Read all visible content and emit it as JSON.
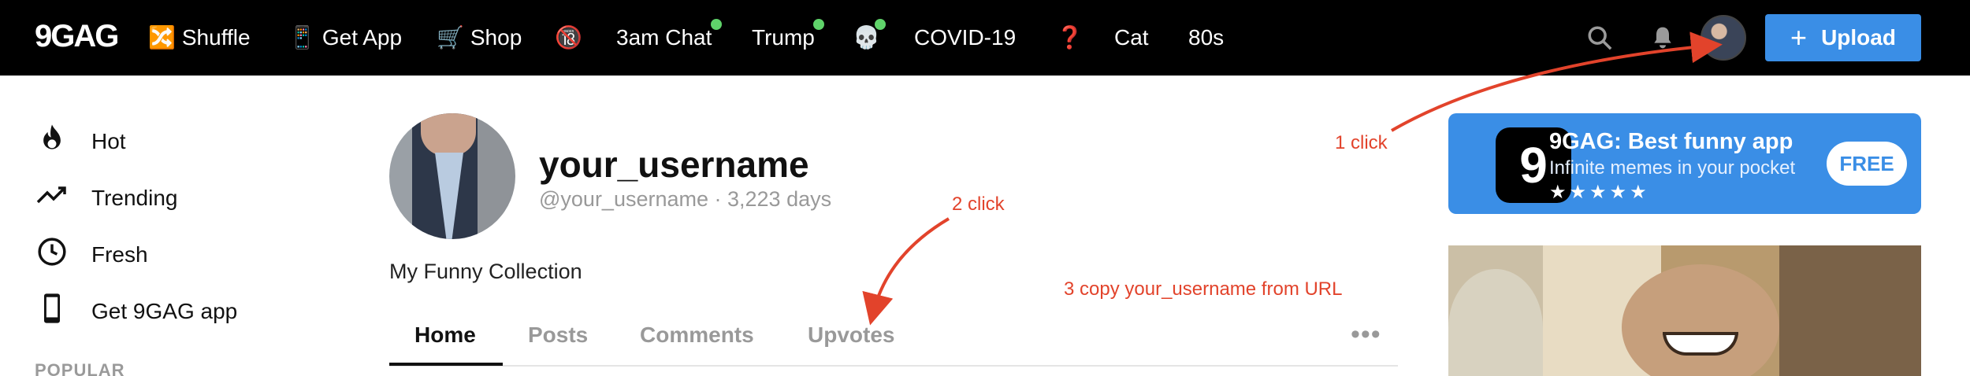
{
  "topbar": {
    "logo": "9GAG",
    "nav": [
      {
        "icon": "🔀",
        "label": "Shuffle"
      },
      {
        "icon": "📱",
        "label": "Get App"
      },
      {
        "icon": "🛒",
        "label": "Shop"
      },
      {
        "icon": "🔞",
        "label": ""
      },
      {
        "icon": "",
        "label": "3am Chat"
      },
      {
        "icon": "",
        "label": "Trump"
      },
      {
        "icon": "💀",
        "label": ""
      },
      {
        "icon": "",
        "label": "COVID-19"
      },
      {
        "icon": "❓",
        "label": ""
      },
      {
        "icon": "",
        "label": "Cat"
      },
      {
        "icon": "",
        "label": "80s"
      }
    ],
    "icons": {
      "night_mode": "moon-icon",
      "search": "search-icon",
      "notifications": "bell-icon"
    },
    "upload_label": "Upload"
  },
  "sidebar": {
    "items": [
      {
        "icon": "flame-icon",
        "label": "Hot"
      },
      {
        "icon": "trending-icon",
        "label": "Trending"
      },
      {
        "icon": "clock-icon",
        "label": "Fresh"
      },
      {
        "icon": "phone-icon",
        "label": "Get 9GAG app"
      }
    ],
    "section_heading": "POPULAR"
  },
  "profile": {
    "name": "your_username",
    "handle": "@your_username · 3,223 days",
    "collection": "My Funny Collection",
    "tabs": [
      "Home",
      "Posts",
      "Comments",
      "Upvotes"
    ],
    "active_tab": "Home"
  },
  "annotations": {
    "step1": "1 click",
    "step2": "2 click",
    "step3": "3 copy your_username from URL",
    "color": "#e2432b"
  },
  "app_banner": {
    "icon_letter": "9",
    "title": "9GAG: Best funny app",
    "subtitle": "Infinite memes in your pocket",
    "stars": "★★★★★",
    "cta": "FREE"
  },
  "colors": {
    "accent": "#3a8ee6",
    "topbar": "#000000",
    "online_dot": "#5fd36a"
  }
}
